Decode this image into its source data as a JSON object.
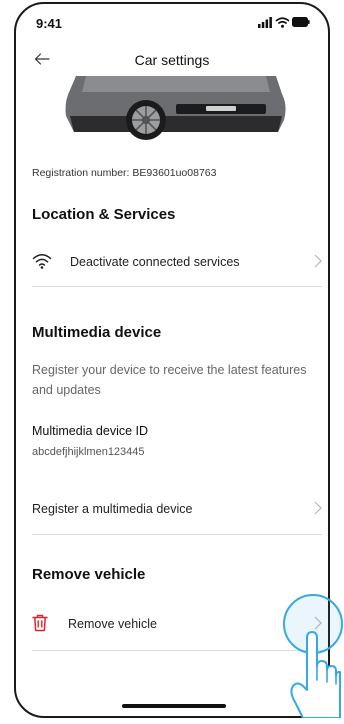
{
  "status_bar": {
    "time": "9:41",
    "icons": [
      "signal-icon",
      "wifi-icon",
      "battery-icon"
    ]
  },
  "header": {
    "title": "Car settings",
    "back_icon": "arrow-left-icon"
  },
  "vehicle": {
    "registration": "Registration number: BE93601uo08763"
  },
  "location_services": {
    "title": "Location & Services",
    "row_label": "Deactivate connected services",
    "row_icon": "wifi-icon"
  },
  "multimedia": {
    "title": "Multimedia device",
    "description": "Register your device to receive the latest features and updates",
    "device_id_label": "Multimedia device ID",
    "device_id_value": "abcdefjhijklmen123445",
    "register_label": "Register a multimedia device"
  },
  "remove": {
    "title": "Remove vehicle",
    "row_label": "Remove vehicle",
    "row_icon": "trash-icon"
  },
  "colors": {
    "text_primary": "#111111",
    "text_secondary": "#666666",
    "divider": "#dcdcdc",
    "danger": "#e0242c",
    "tap_highlight": "#35a9e6"
  }
}
